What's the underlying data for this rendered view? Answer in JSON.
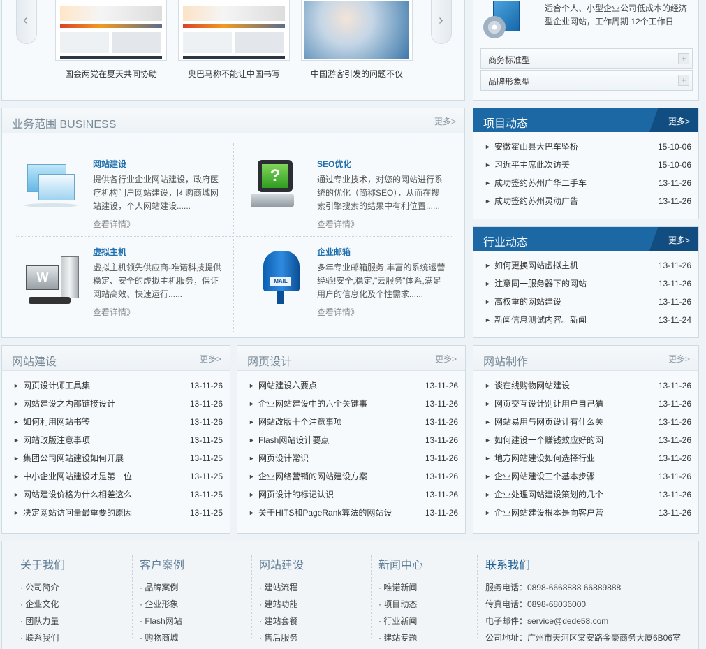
{
  "gallery": {
    "captions": [
      "国会两党在夏天共同协助",
      "奥巴马称不能让中国书写",
      "中国游客引发的问题不仅"
    ]
  },
  "product": {
    "desc": "适合个人、小型企业公司低成本的经济型企业网站，工作周期 12个工作日",
    "options": [
      "商务标准型",
      "品牌形象型"
    ]
  },
  "business": {
    "title": "业务范围 BUSINESS",
    "more": "更多>",
    "items": [
      {
        "title": "网站建设",
        "desc": "提供各行业企业网站建设，政府医疗机构门户网站建设，团购商城网站建设，个人网站建设......",
        "more": "查看详情》"
      },
      {
        "title": "SEO优化",
        "desc": "通过专业技术，对您的网站进行系统的优化（简称SEO），从而在搜索引擎搜索的结果中有利位置......",
        "more": "查看详情》"
      },
      {
        "title": "虚拟主机",
        "desc": "虚拟主机领先供应商-唯诺科技提供稳定、安全的虚拟主机服务，保证网站高效、快速运行......",
        "more": "查看详情》"
      },
      {
        "title": "企业邮箱",
        "desc": "多年专业邮箱服务,丰富的系统运营经验!安全,稳定,\"云服务\"体系,满足用户的信息化及个性需求......",
        "more": "查看详情》"
      }
    ]
  },
  "project_news": {
    "title": "项目动态",
    "more": "更多>",
    "items": [
      {
        "text": "安徽霍山县大巴车坠桥",
        "date": "15-10-06"
      },
      {
        "text": "习近平主席此次访美",
        "date": "15-10-06"
      },
      {
        "text": "成功签约苏州广华二手车",
        "date": "13-11-26"
      },
      {
        "text": "成功签约苏州灵动广告",
        "date": "13-11-26"
      }
    ]
  },
  "industry_news": {
    "title": "行业动态",
    "more": "更多>",
    "items": [
      {
        "text": "如何更换网站虚拟主机",
        "date": "13-11-26"
      },
      {
        "text": "注意同一服务器下的网站",
        "date": "13-11-26"
      },
      {
        "text": "高权重的网站建设",
        "date": "13-11-26"
      },
      {
        "text": "新闻信息测试内容。新闻",
        "date": "13-11-24"
      }
    ]
  },
  "col1": {
    "title": "网站建设",
    "more": "更多>",
    "items": [
      {
        "text": "网页设计师工具集",
        "date": "13-11-26"
      },
      {
        "text": "网站建设之内部链接设计",
        "date": "13-11-26"
      },
      {
        "text": "如何利用网站书签",
        "date": "13-11-26"
      },
      {
        "text": "网站改版注意事项",
        "date": "13-11-25"
      },
      {
        "text": "集团公司网站建设如何开展",
        "date": "13-11-25"
      },
      {
        "text": "中小企业网站建设才是第一位",
        "date": "13-11-25"
      },
      {
        "text": "网站建设价格为什么相差这么",
        "date": "13-11-25"
      },
      {
        "text": "决定网站访问量最重要的原因",
        "date": "13-11-25"
      }
    ]
  },
  "col2": {
    "title": "网页设计",
    "more": "更多>",
    "items": [
      {
        "text": "网站建设六要点",
        "date": "13-11-26"
      },
      {
        "text": "企业网站建设中的六个关键事",
        "date": "13-11-26"
      },
      {
        "text": "网站改版十个注意事项",
        "date": "13-11-26"
      },
      {
        "text": "Flash网站设计要点",
        "date": "13-11-26"
      },
      {
        "text": "网页设计常识",
        "date": "13-11-26"
      },
      {
        "text": "企业网络营销的网站建设方案",
        "date": "13-11-26"
      },
      {
        "text": "网页设计的标记认识",
        "date": "13-11-26"
      },
      {
        "text": "关于HITS和PageRank算法的网站设",
        "date": "13-11-26"
      }
    ]
  },
  "col3": {
    "title": "网站制作",
    "more": "更多>",
    "items": [
      {
        "text": "谈在线购物网站建设",
        "date": "13-11-26"
      },
      {
        "text": "网页交互设计别让用户自己猜",
        "date": "13-11-26"
      },
      {
        "text": "网站易用与网页设计有什么关",
        "date": "13-11-26"
      },
      {
        "text": "如何建设一个赚钱效应好的网",
        "date": "13-11-26"
      },
      {
        "text": "地方网站建设如何选择行业",
        "date": "13-11-26"
      },
      {
        "text": "企业网站建设三个基本步骤",
        "date": "13-11-26"
      },
      {
        "text": "企业处理网站建设策划的几个",
        "date": "13-11-26"
      },
      {
        "text": "企业网站建设根本是向客户营",
        "date": "13-11-26"
      }
    ]
  },
  "footer": {
    "about": {
      "title": "关于我们",
      "items": [
        "· 公司简介",
        "· 企业文化",
        "· 团队力量",
        "· 联系我们"
      ]
    },
    "cases": {
      "title": "客户案例",
      "items": [
        "· 品牌案例",
        "· 企业形象",
        "· Flash网站",
        "· 购物商城"
      ]
    },
    "build": {
      "title": "网站建设",
      "items": [
        "· 建站流程",
        "· 建站功能",
        "· 建站套餐",
        "· 售后服务"
      ]
    },
    "news": {
      "title": "新闻中心",
      "items": [
        "· 唯诺新闻",
        "· 项目动态",
        "· 行业新闻",
        "· 建站专题"
      ]
    },
    "contact": {
      "title": "联系我们",
      "items": [
        "服务电话：0898-6668888 66889888",
        "传真电话：0898-68036000",
        "电子邮件：service@dede58.com",
        "公司地址：广州市天河区棠安路金豪商务大厦6B06室"
      ]
    }
  }
}
